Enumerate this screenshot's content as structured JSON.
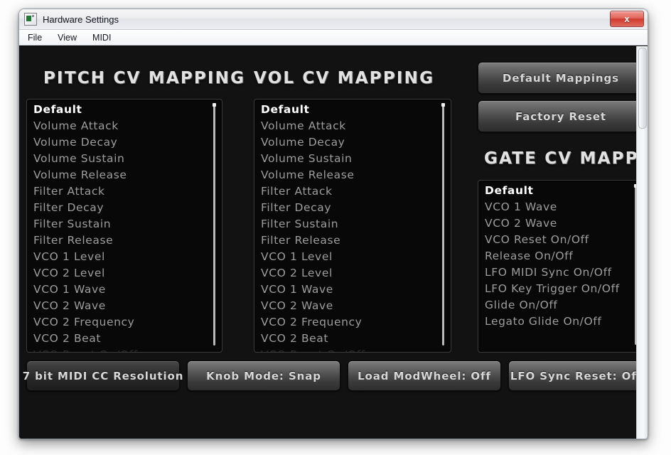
{
  "window": {
    "title": "Hardware Settings",
    "icon": "app-window-icon",
    "close_label": "x"
  },
  "menubar": {
    "items": [
      {
        "label": "File"
      },
      {
        "label": "View"
      },
      {
        "label": "MIDI"
      }
    ]
  },
  "panels": {
    "pitch": {
      "title": "PITCH CV MAPPING",
      "items": [
        "Default",
        "Volume Attack",
        "Volume Decay",
        "Volume Sustain",
        "Volume Release",
        "Filter Attack",
        "Filter Decay",
        "Filter Sustain",
        "Filter Release",
        "VCO 1 Level",
        "VCO 2 Level",
        "VCO 1 Wave",
        "VCO 2 Wave",
        "VCO 2 Frequency",
        "VCO 2 Beat",
        "VCO Reset On/Off"
      ],
      "selected_index": 0
    },
    "vol": {
      "title": "VOL CV MAPPING",
      "items": [
        "Default",
        "Volume Attack",
        "Volume Decay",
        "Volume Sustain",
        "Volume Release",
        "Filter Attack",
        "Filter Decay",
        "Filter Sustain",
        "Filter Release",
        "VCO 1 Level",
        "VCO 2 Level",
        "VCO 1 Wave",
        "VCO 2 Wave",
        "VCO 2 Frequency",
        "VCO 2 Beat",
        "VCO Reset On/Off"
      ],
      "selected_index": 0
    },
    "gate": {
      "title": "GATE CV MAPPING",
      "items": [
        "Default",
        "VCO 1 Wave",
        "VCO 2 Wave",
        "VCO Reset On/Off",
        "Release On/Off",
        "LFO MIDI Sync On/Off",
        "LFO Key Trigger On/Off",
        "Glide On/Off",
        "Legato Glide On/Off"
      ],
      "selected_index": 0
    }
  },
  "actions": {
    "default_mappings": "Default Mappings",
    "factory_reset": "Factory Reset"
  },
  "footer": {
    "buttons": [
      {
        "label": "7 bit MIDI CC Resolution",
        "state": "dark"
      },
      {
        "label": "Knob Mode: Snap",
        "state": "normal"
      },
      {
        "label": "Load ModWheel: Off",
        "state": "normal"
      },
      {
        "label": "LFO Sync Reset: Off",
        "state": "normal"
      }
    ]
  },
  "colors": {
    "canvas_bg": "#121212",
    "list_bg": "#080808",
    "list_text": "#9d9d9d",
    "selected_text": "#ffffff",
    "title_text": "#e2e2e2",
    "button_text": "#d7d7d7",
    "close_button": "#cf3a2e"
  }
}
